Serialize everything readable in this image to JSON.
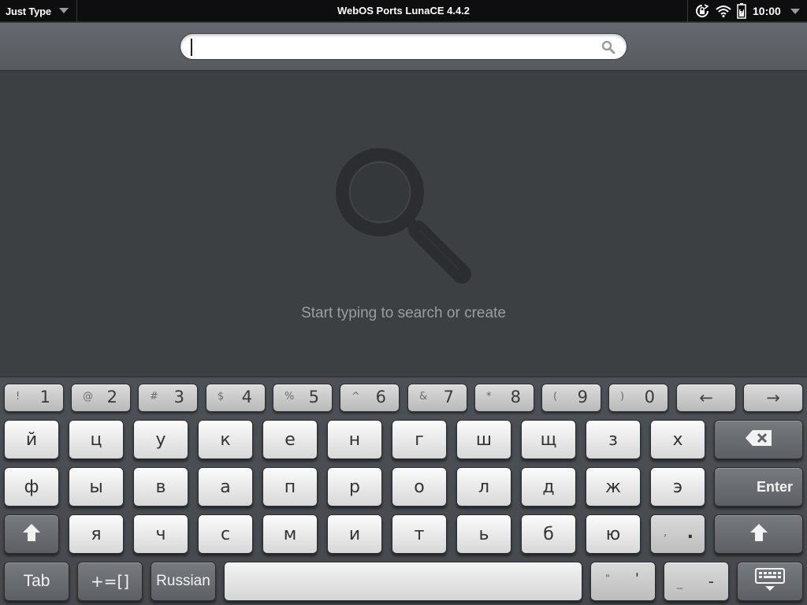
{
  "statusbar": {
    "menu_label": "Just Type",
    "carrier": "WebOS Ports LunaCE 4.4.2",
    "clock": "10:00"
  },
  "search": {
    "value": "",
    "placeholder": ""
  },
  "empty_state": {
    "message": "Start typing to search or create"
  },
  "keyboard": {
    "number_row": [
      {
        "sup": "!",
        "main": "1"
      },
      {
        "sup": "@",
        "main": "2"
      },
      {
        "sup": "#",
        "main": "3"
      },
      {
        "sup": "$",
        "main": "4"
      },
      {
        "sup": "%",
        "main": "5"
      },
      {
        "sup": "^",
        "main": "6"
      },
      {
        "sup": "&",
        "main": "7"
      },
      {
        "sup": "*",
        "main": "8"
      },
      {
        "sup": "(",
        "main": "9"
      },
      {
        "sup": ")",
        "main": "0"
      }
    ],
    "arrow_left": "←",
    "arrow_right": "→",
    "row1": [
      "й",
      "ц",
      "у",
      "к",
      "е",
      "н",
      "г",
      "ш",
      "щ",
      "з",
      "х"
    ],
    "row2": [
      "ф",
      "ы",
      "в",
      "а",
      "п",
      "р",
      "о",
      "л",
      "д",
      "ж",
      "э"
    ],
    "row3": [
      "я",
      "ч",
      "с",
      "м",
      "и",
      "т",
      "ь",
      "б",
      "ю"
    ],
    "enter_label": "Enter",
    "comma_period": {
      "sup": ",",
      "main": "."
    },
    "tab_label": "Tab",
    "symbols_label": "+=[]",
    "language_label": "Russian",
    "quote_key": {
      "sup": "\"",
      "main": "'"
    },
    "dash_key": {
      "sup": "_",
      "main": "-"
    }
  },
  "icons": {
    "search": "search-icon",
    "empty": "magnifier-icon",
    "backspace": "backspace-icon",
    "shift": "shift-icon",
    "hide_keyboard": "hide-keyboard-icon",
    "rotation_lock": "rotation-lock-icon",
    "wifi": "wifi-icon",
    "battery": "battery-icon"
  }
}
